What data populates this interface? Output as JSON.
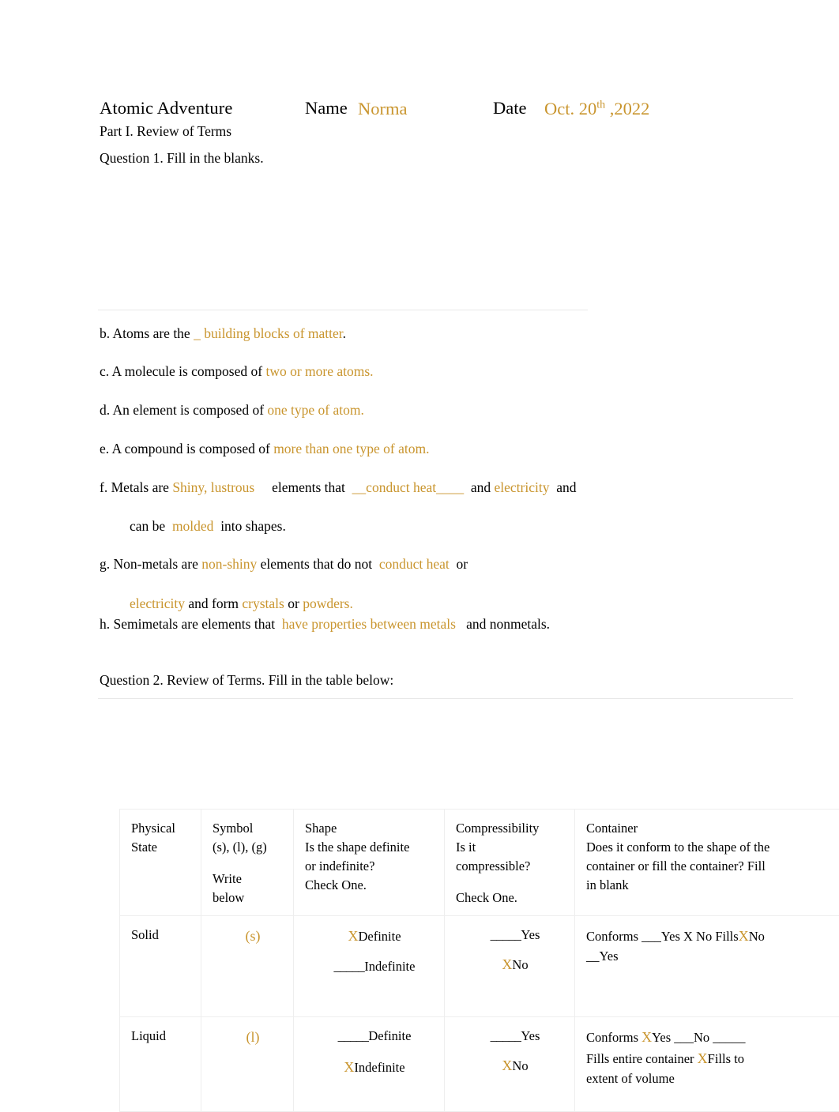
{
  "header": {
    "doc_title": "Atomic Adventure",
    "name_label": "Name",
    "name_value": "Norma",
    "date_label": "Date",
    "date_month_day": "Oct. 20",
    "date_ordinal": "th",
    "date_year": ",2022",
    "part_line": "Part I. Review of Terms",
    "question1": "Question 1. Fill in the blanks."
  },
  "blanks": {
    "b": {
      "lead": "b. Atoms are the",
      "answer": "_ building blocks of matter",
      "tail": "."
    },
    "c": {
      "lead": "c.  A molecule is composed of",
      "answer": "two or more atoms."
    },
    "d": {
      "lead": "d.  An element is composed of",
      "answer": "one type of atom."
    },
    "e": {
      "lead": "e.  A compound is composed of",
      "answer": "more than one type of atom."
    },
    "f": {
      "lead": "f. Metals are",
      "answer1": "Shiny, lustrous",
      "mid1": "elements that",
      "answer2": "__conduct heat____",
      "mid2": "and",
      "answer3": "electricity",
      "tail": "and",
      "line2_lead": "can be",
      "line2_answer": "molded",
      "line2_tail": "into shapes."
    },
    "g": {
      "lead": "g. Non-metals are",
      "answer1": "non-shiny",
      "mid1": "elements that do not",
      "answer2": "conduct heat",
      "tail": "or",
      "line2_answer1": "electricity",
      "line2_mid": "and form",
      "line2_answer2": "crystals",
      "line2_mid2": "or",
      "line2_answer3": "powders."
    },
    "h": {
      "lead": "h. Semimetals are elements that",
      "answer": "have properties between metals",
      "tail": "and nonmetals."
    }
  },
  "question2": "Question 2. Review of Terms. Fill in the table below:",
  "table": {
    "headers": {
      "physical_state_l1": "Physical",
      "physical_state_l2": "State",
      "symbol_l1": "Symbol",
      "symbol_l2": "(s), (l), (g)",
      "symbol_l3": "Write",
      "symbol_l4": "below",
      "shape_l1": "Shape",
      "shape_l2": "Is the shape definite",
      "shape_l3": "or indefinite?",
      "shape_l4": "Check One.",
      "compress_l1": "Compressibility",
      "compress_l2": "Is it",
      "compress_l3": "compressible?",
      "compress_l4": "Check One.",
      "container_l1": "Container",
      "container_l2": "Does it conform to the shape of the",
      "container_l3": "container or fill the container? Fill",
      "container_l4": "in blank"
    },
    "rows": [
      {
        "state": "Solid",
        "symbol": "(s)",
        "shape_mark1": "X",
        "shape_label1": "Definite",
        "shape_mark2": "_____",
        "shape_label2": "Indefinite",
        "comp_mark1": "_____",
        "comp_label1": "Yes",
        "comp_mark2": "X",
        "comp_label2": "No",
        "container_pre1": "Conforms ___Yes X No Fills",
        "container_mark1": "X",
        "container_post1": "No",
        "container_line2": "__Yes",
        "container_mark2": "",
        "container_line3": ""
      },
      {
        "state": "Liquid",
        "symbol": "(l)",
        "shape_mark1": "_____",
        "shape_label1": "Definite",
        "shape_mark2": "X",
        "shape_label2": "Indefinite",
        "comp_mark1": "_____",
        "comp_label1": "Yes",
        "comp_mark2": "X",
        "comp_label2": "No",
        "container_pre1": "Conforms ",
        "container_mark1": "X",
        "container_post1": "Yes ___No _____",
        "container_line2": "Fills entire container ",
        "container_mark2": "X",
        "container_line3": "Fills to"
      }
    ],
    "liquid_extra_line": "extent of volume"
  }
}
